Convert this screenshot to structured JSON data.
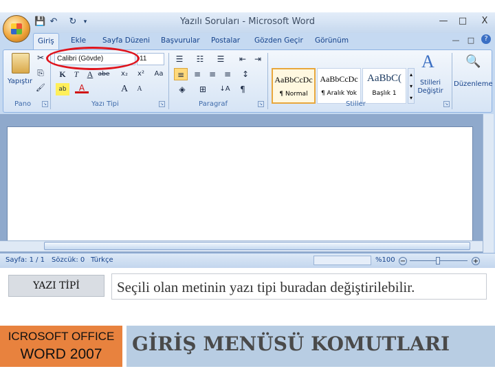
{
  "window": {
    "title": "Yazılı Soruları - Microsoft Word",
    "controls": {
      "minimize": "—",
      "maximize": "□",
      "close": "X"
    },
    "inner_controls": {
      "minimize": "—",
      "restore": "□",
      "close": "x"
    }
  },
  "quick_access": {
    "save": "💾",
    "undo": "↶",
    "redo": "↻",
    "more": "▾"
  },
  "tabs": [
    "Giriş",
    "Ekle",
    "Sayfa Düzeni",
    "Başvurular",
    "Postalar",
    "Gözden Geçir",
    "Görünüm"
  ],
  "ribbon": {
    "help": "?",
    "pano": {
      "label": "Pano",
      "paste": "Yapıştır",
      "cut": "✂",
      "copy": "⎘",
      "format_painter": "🖌"
    },
    "yazi_tipi": {
      "label": "Yazı Tipi",
      "font_name": "Calibri (Gövde)",
      "font_size": "11",
      "bold": "K",
      "italic": "T",
      "underline": "A",
      "strike": "abe",
      "subscript": "x₂",
      "superscript": "x²",
      "grow": "A",
      "shrink": "A",
      "clear": "Aa",
      "highlight": "ab",
      "font_color": "A"
    },
    "paragraf": {
      "label": "Paragraf"
    },
    "stiller": {
      "label": "Stiller",
      "styles": [
        {
          "preview": "AaBbCcDc",
          "name": "¶ Normal"
        },
        {
          "preview": "AaBbCcDc",
          "name": "¶ Aralık Yok"
        },
        {
          "preview": "AaBbC(",
          "name": "Başlık 1"
        }
      ],
      "change_styles": "Stilleri Değiştir"
    },
    "duzenleme": {
      "label": "Düzenleme"
    }
  },
  "status_bar": {
    "page": "Sayfa: 1 / 1",
    "words": "Sözcük: 0",
    "language": "Türkçe",
    "zoom": "%100"
  },
  "slide": {
    "term": "YAZI TİPİ",
    "description": "Seçili olan metinin yazı tipi buradan değiştirilebilir.",
    "product_line1": "ICROSOFT OFFICE",
    "product_line2": "WORD 2007",
    "heading": "GİRİŞ MENÜSÜ KOMUTLARI"
  }
}
